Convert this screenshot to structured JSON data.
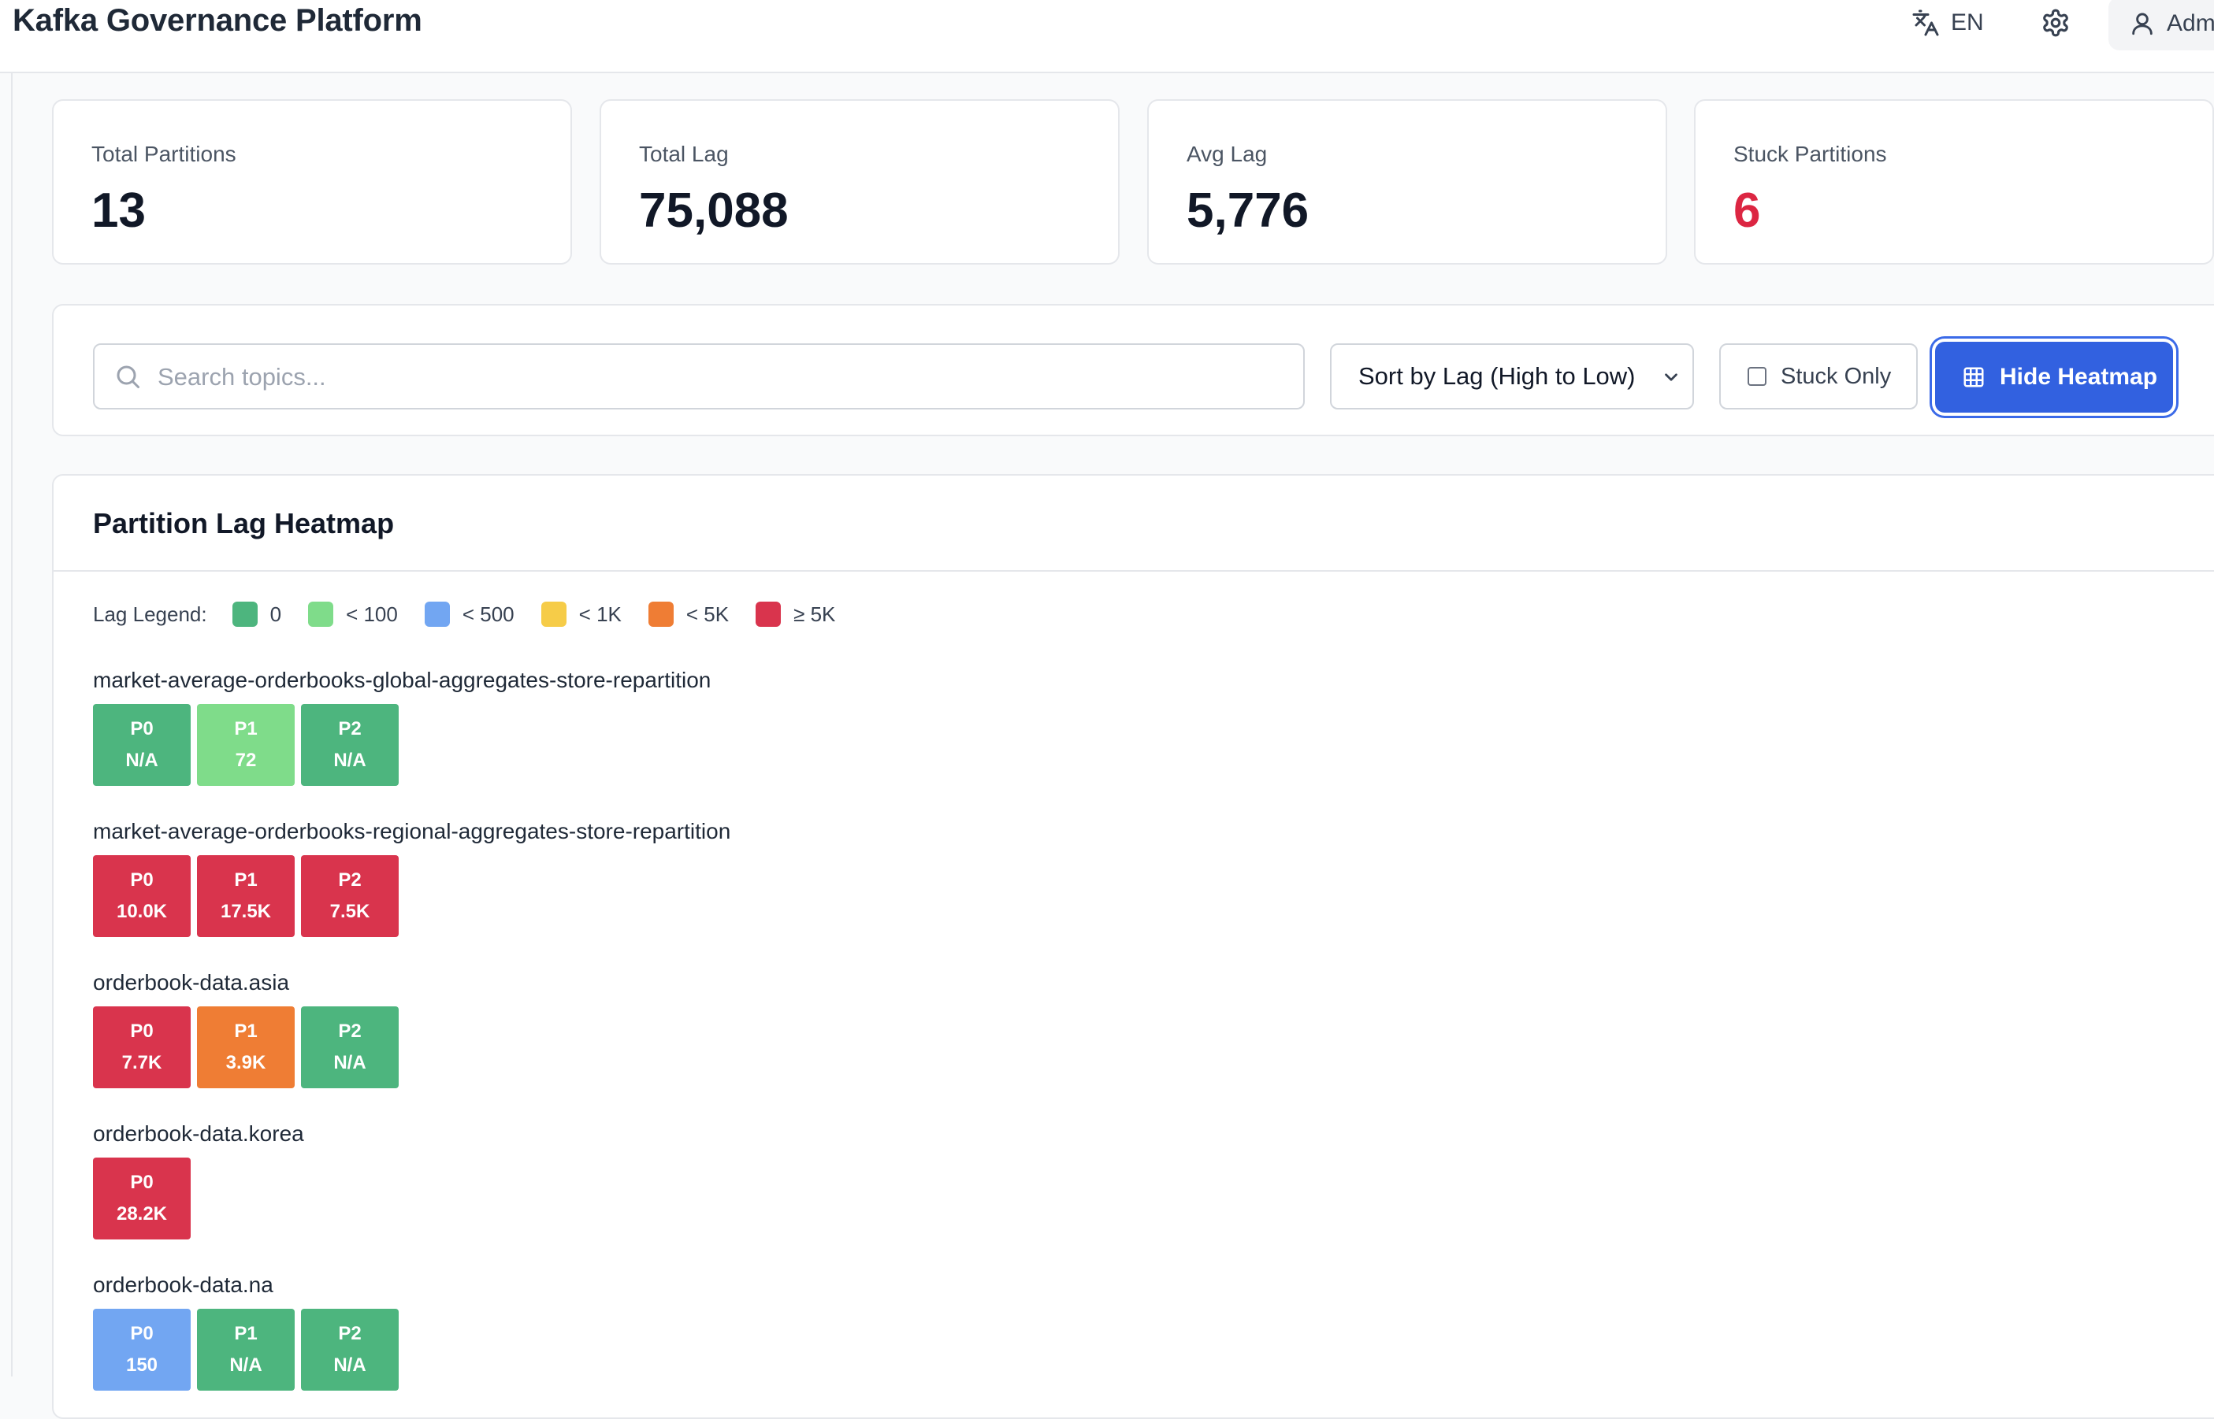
{
  "header": {
    "app_title": "Kafka Governance Platform",
    "language": "EN",
    "user_label": "Adm"
  },
  "stats": [
    {
      "label": "Total Partitions",
      "value": "13"
    },
    {
      "label": "Total Lag",
      "value": "75,088"
    },
    {
      "label": "Avg Lag",
      "value": "5,776"
    },
    {
      "label": "Stuck Partitions",
      "value": "6"
    }
  ],
  "filters": {
    "search_placeholder": "Search topics...",
    "search_value": "",
    "sort_selected": "Sort by Lag (High to Low)",
    "stuck_only_label": "Stuck Only",
    "stuck_only_checked": false,
    "heatmap_button_label": "Hide Heatmap"
  },
  "heatmap": {
    "title": "Partition Lag Heatmap",
    "legend_label": "Lag Legend:",
    "legend": [
      {
        "label": "0",
        "color": "#4db57e"
      },
      {
        "label": "< 100",
        "color": "#7fdc8a"
      },
      {
        "label": "< 500",
        "color": "#72a6f2"
      },
      {
        "label": "< 1K",
        "color": "#f6cc48"
      },
      {
        "label": "< 5K",
        "color": "#ef7d34"
      },
      {
        "label": "≥ 5K",
        "color": "#d9344d"
      }
    ],
    "topics": [
      {
        "name": "market-average-orderbooks-global-aggregates-store-repartition",
        "partitions": [
          {
            "id": "P0",
            "lag": "N/A",
            "color": "#4db57e"
          },
          {
            "id": "P1",
            "lag": "72",
            "color": "#7fdc8a"
          },
          {
            "id": "P2",
            "lag": "N/A",
            "color": "#4db57e"
          }
        ]
      },
      {
        "name": "market-average-orderbooks-regional-aggregates-store-repartition",
        "partitions": [
          {
            "id": "P0",
            "lag": "10.0K",
            "color": "#d9344d"
          },
          {
            "id": "P1",
            "lag": "17.5K",
            "color": "#d9344d"
          },
          {
            "id": "P2",
            "lag": "7.5K",
            "color": "#d9344d"
          }
        ]
      },
      {
        "name": "orderbook-data.asia",
        "partitions": [
          {
            "id": "P0",
            "lag": "7.7K",
            "color": "#d9344d"
          },
          {
            "id": "P1",
            "lag": "3.9K",
            "color": "#ef7d34"
          },
          {
            "id": "P2",
            "lag": "N/A",
            "color": "#4db57e"
          }
        ]
      },
      {
        "name": "orderbook-data.korea",
        "partitions": [
          {
            "id": "P0",
            "lag": "28.2K",
            "color": "#d9344d"
          }
        ]
      },
      {
        "name": "orderbook-data.na",
        "partitions": [
          {
            "id": "P0",
            "lag": "150",
            "color": "#72a6f2"
          },
          {
            "id": "P1",
            "lag": "N/A",
            "color": "#4db57e"
          },
          {
            "id": "P2",
            "lag": "N/A",
            "color": "#4db57e"
          }
        ]
      }
    ]
  }
}
